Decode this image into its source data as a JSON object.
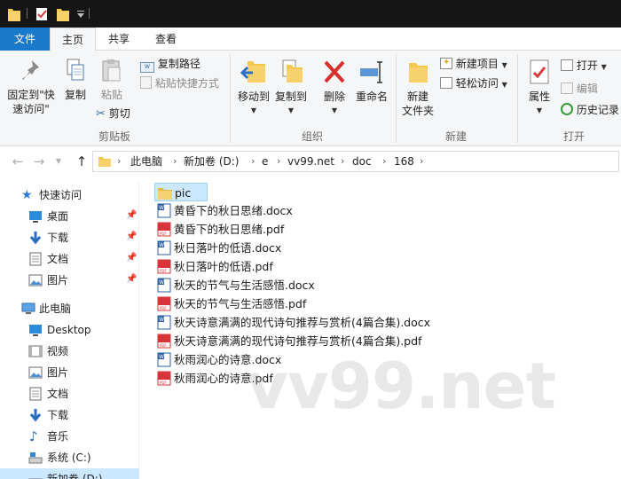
{
  "ribbon_tabs": [
    {
      "label": "文件"
    },
    {
      "label": "主页"
    },
    {
      "label": "共享"
    },
    {
      "label": "查看"
    }
  ],
  "ribbon": {
    "pin": {
      "line1": "固定到\"快",
      "line2": "速访问\""
    },
    "copy": "复制",
    "paste": "粘贴",
    "copy_path": "复制路径",
    "paste_shortcut": "粘贴快捷方式",
    "cut": "剪切",
    "clipboard_group": "剪贴板",
    "move_to": "移动到",
    "copy_to": "复制到",
    "delete": "删除",
    "rename": "重命名",
    "organize_group": "组织",
    "new_folder": {
      "line1": "新建",
      "line2": "文件夹"
    },
    "new_item": "新建项目",
    "easy_access": "轻松访问",
    "new_group": "新建",
    "properties": "属性",
    "open": "打开",
    "edit": "编辑",
    "history": "历史记录",
    "open_group": "打开"
  },
  "address": {
    "crumbs": [
      "此电脑",
      "新加卷 (D:)",
      "e",
      "vv99.net",
      "doc",
      "168"
    ]
  },
  "nav_pane": {
    "quick_access": "快速访问",
    "qa_items": [
      "桌面",
      "下载",
      "文档",
      "图片"
    ],
    "this_pc": "此电脑",
    "pc_items": [
      "Desktop",
      "视频",
      "图片",
      "文档",
      "下载",
      "音乐",
      "系统 (C:)",
      "新加卷 (D:)"
    ]
  },
  "files": [
    {
      "name": "pic",
      "type": "folder"
    },
    {
      "name": "黄昏下的秋日思绪.docx",
      "type": "docx"
    },
    {
      "name": "黄昏下的秋日思绪.pdf",
      "type": "pdf"
    },
    {
      "name": "秋日落叶的低语.docx",
      "type": "docx"
    },
    {
      "name": "秋日落叶的低语.pdf",
      "type": "pdf"
    },
    {
      "name": "秋天的节气与生活感悟.docx",
      "type": "docx"
    },
    {
      "name": "秋天的节气与生活感悟.pdf",
      "type": "pdf"
    },
    {
      "name": "秋天诗意满满的现代诗句推荐与赏析(4篇合集).docx",
      "type": "docx"
    },
    {
      "name": "秋天诗意满满的现代诗句推荐与赏析(4篇合集).pdf",
      "type": "pdf"
    },
    {
      "name": "秋雨润心的诗意.docx",
      "type": "docx"
    },
    {
      "name": "秋雨润心的诗意.pdf",
      "type": "pdf"
    }
  ],
  "watermark": "vv99.net",
  "colors": {
    "accent": "#1979ca",
    "selection": "#cce8ff",
    "folder": "#f7d16b",
    "pdf": "#d8343a",
    "word": "#2b5fa6"
  }
}
